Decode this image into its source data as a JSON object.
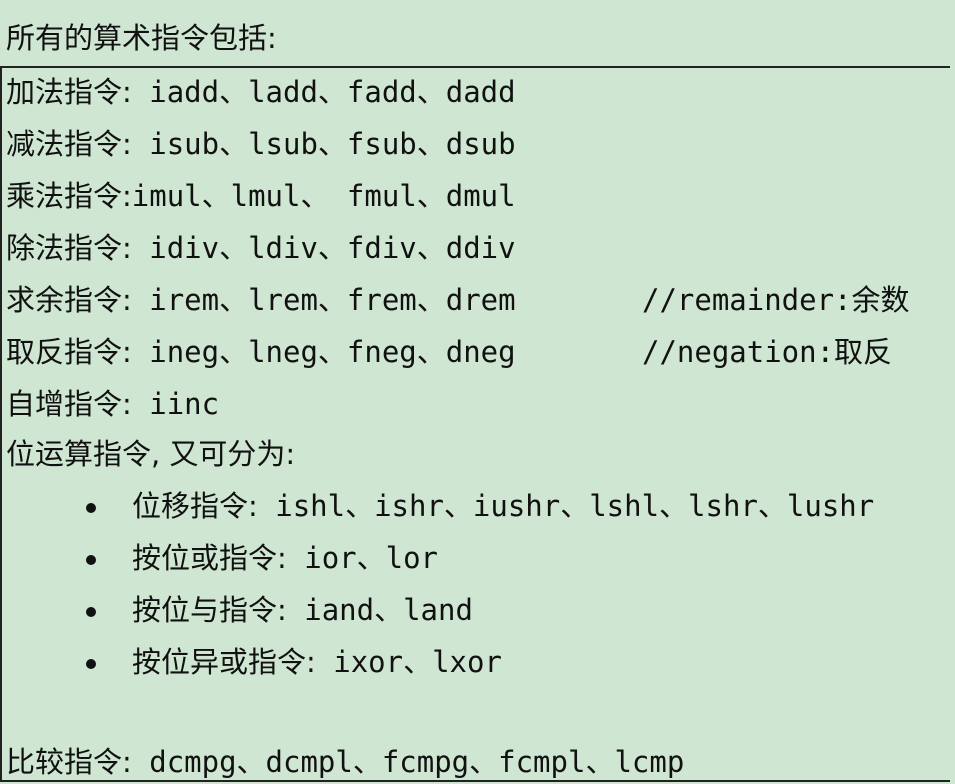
{
  "heading": "所有的算术指令包括:",
  "rows": [
    {
      "label": "加法指令:",
      "code": "iadd、ladd、fadd、dadd"
    },
    {
      "label": "减法指令:",
      "code": "isub、lsub、fsub、dsub"
    },
    {
      "label": "乘法指令:",
      "code": "imul、lmul、 fmul、dmul"
    },
    {
      "label": "除法指令:",
      "code": "idiv、ldiv、fdiv、ddiv"
    },
    {
      "label": "求余指令:",
      "code": "irem、lrem、frem、drem",
      "comment": "//remainder:余数"
    },
    {
      "label": "取反指令:",
      "code": "ineg、lneg、fneg、dneg",
      "comment": "//negation:取反"
    },
    {
      "label": "自增指令:",
      "code": "iinc"
    },
    {
      "label": "位运算指令, 又可分为:",
      "code": ""
    }
  ],
  "bullets": [
    {
      "label": "位移指令:",
      "code": "ishl、ishr、iushr、lshl、lshr、lushr"
    },
    {
      "label": "按位或指令:",
      "code": "ior、lor"
    },
    {
      "label": "按位与指令:",
      "code": "iand、land"
    },
    {
      "label": "按位异或指令:",
      "code": "ixor、lxor"
    }
  ],
  "compare": {
    "label": "比较指令:",
    "code": "dcmpg、dcmpl、fcmpg、fcmpl、lcmp"
  }
}
